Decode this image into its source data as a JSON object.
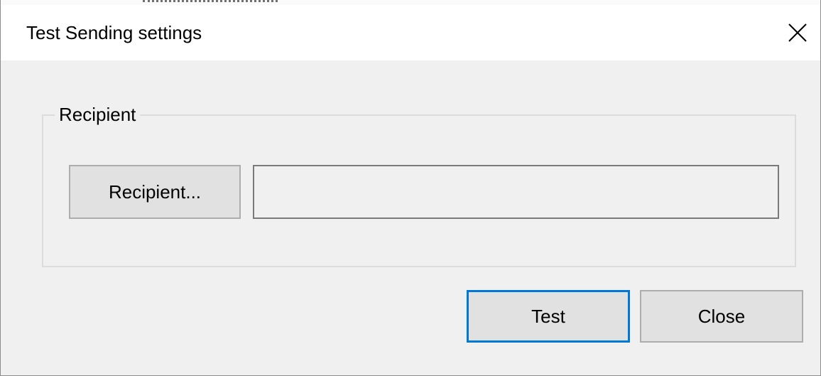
{
  "window": {
    "title": "Test Sending settings"
  },
  "icons": {
    "close": "close-icon"
  },
  "recipient_group": {
    "label": "Recipient",
    "recipient_button_label": "Recipient...",
    "recipient_value": ""
  },
  "footer": {
    "test_label": "Test",
    "close_label": "Close"
  },
  "colors": {
    "background": "#f0f0f0",
    "titlebar": "#ffffff",
    "button_face": "#e1e1e1",
    "button_border": "#adadad",
    "focus_accent": "#0078d7",
    "groupbox_border": "#dcdcdc"
  }
}
